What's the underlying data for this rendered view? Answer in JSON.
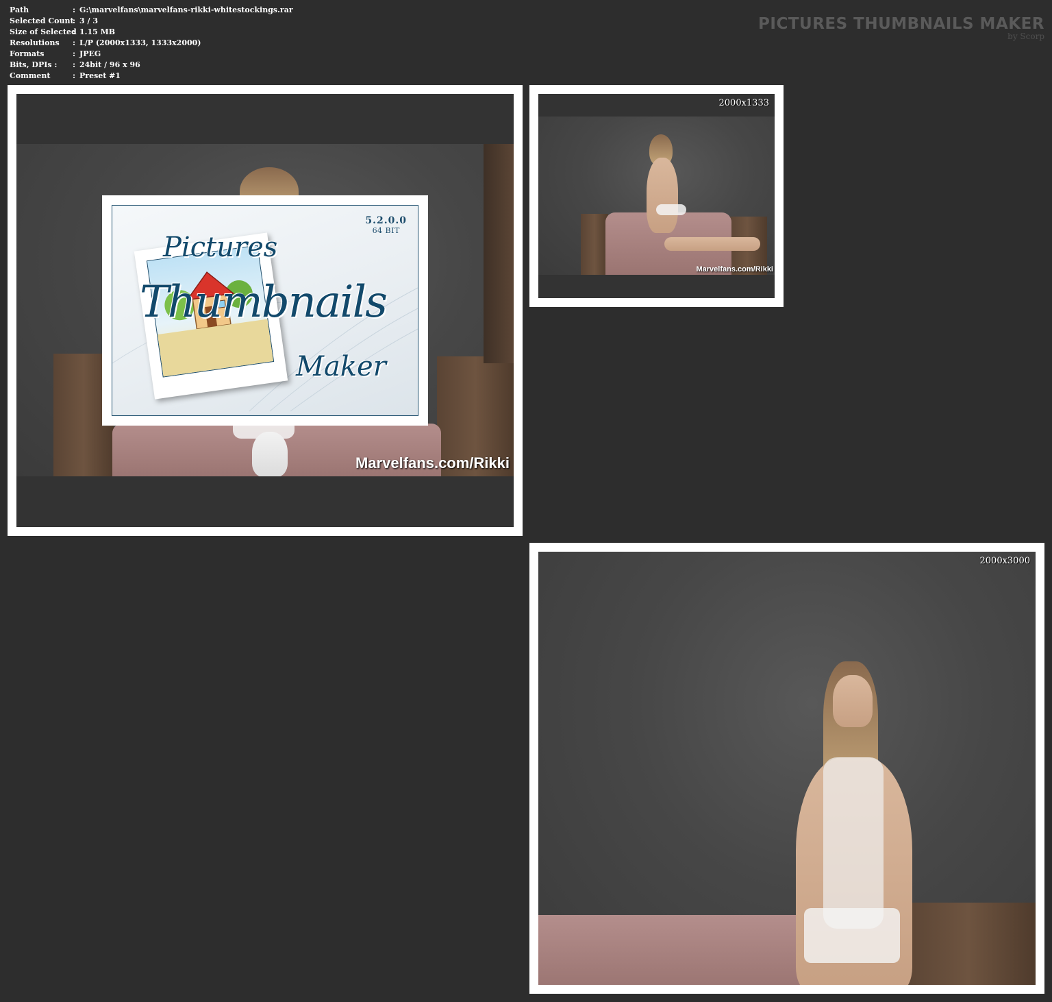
{
  "info": {
    "rows": [
      {
        "key": "Path",
        "sep": ":",
        "value": "G:\\marvelfans\\marvelfans-rikki-whitestockings.rar"
      },
      {
        "key": "Selected Count",
        "sep": ":",
        "value": "3 / 3"
      },
      {
        "key": "Size of Selected",
        "sep": ":",
        "value": "1.15 MB"
      },
      {
        "key": "Resolutions",
        "sep": ":",
        "value": "L/P (2000x1333, 1333x2000)"
      },
      {
        "key": "Formats",
        "sep": ":",
        "value": "JPEG"
      },
      {
        "key": "Bits, DPIs :",
        "sep": ":",
        "value": "24bit / 96 x 96"
      },
      {
        "key": "Comment",
        "sep": ":",
        "value": "Preset #1"
      }
    ]
  },
  "brand": {
    "title": "PICTURES THUMBNAILS MAKER",
    "subtitle": "by Scorp"
  },
  "splash": {
    "version": "5.2.0.0",
    "bits": "64 BIT",
    "word1": "Pictures",
    "word2": "Thumbnails",
    "word3": "Maker"
  },
  "thumbnails": [
    {
      "resolution": "",
      "watermark": "Marvelfans.com/Rikki"
    },
    {
      "resolution": "2000x1333",
      "watermark": "Marvelfans.com/Rikki"
    },
    {
      "resolution": "2000x3000",
      "watermark": ""
    }
  ],
  "colors": {
    "background": "#2d2d2d",
    "frame": "#ffffff",
    "brand_text": "#5a5a5a",
    "splash_accent": "#1d4d6c"
  }
}
